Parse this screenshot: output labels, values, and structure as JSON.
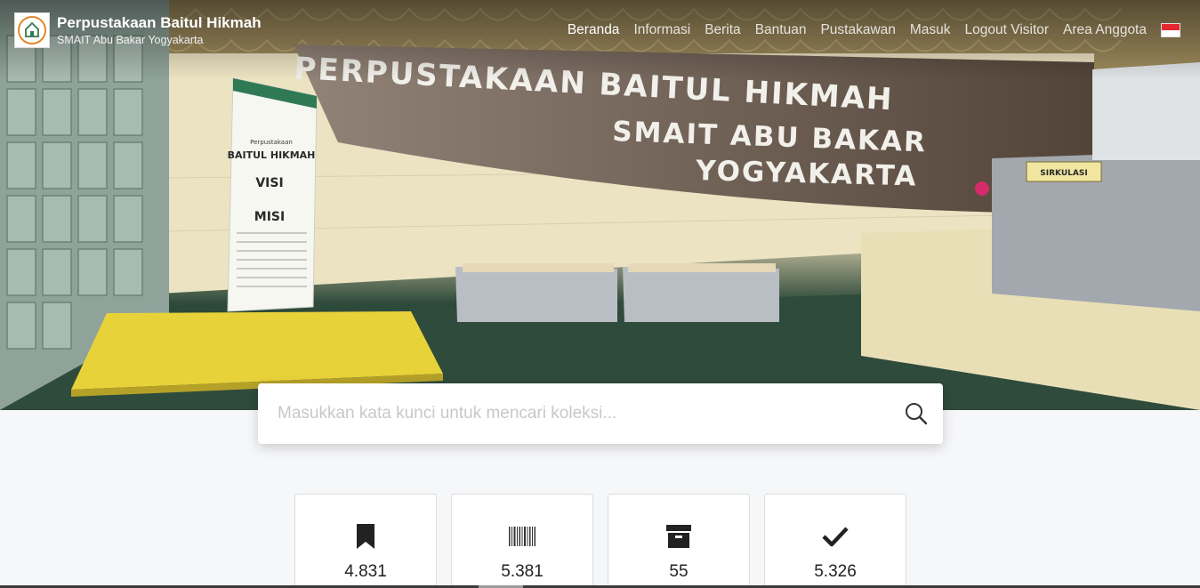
{
  "brand": {
    "title": "Perpustakaan Baitul Hikmah",
    "subtitle": "SMAIT Abu Bakar Yogyakarta",
    "logo_icon": "library-logo-icon"
  },
  "nav": {
    "items": [
      {
        "label": "Beranda",
        "active": true
      },
      {
        "label": "Informasi",
        "active": false
      },
      {
        "label": "Berita",
        "active": false
      },
      {
        "label": "Bantuan",
        "active": false
      },
      {
        "label": "Pustakawan",
        "active": false
      },
      {
        "label": "Masuk",
        "active": false
      },
      {
        "label": "Logout Visitor",
        "active": false
      },
      {
        "label": "Area Anggota",
        "active": false
      }
    ],
    "language_flag": "indonesia-flag-icon"
  },
  "hero": {
    "wall_sign": [
      "PERPUSTAKAAN BAITUL HIKMAH",
      "SMAIT ABU BAKAR",
      "YOGYAKARTA"
    ],
    "banner": {
      "line1": "Perpustakaan",
      "line2": "BAITUL HIKMAH",
      "visi": "VISI",
      "misi": "MISI"
    },
    "counter_sign": "SIRKULASI"
  },
  "search": {
    "placeholder": "Masukkan kata kunci untuk mencari koleksi...",
    "value": "",
    "icon": "search-icon"
  },
  "stats": [
    {
      "icon": "bookmark-icon",
      "value": "4.831"
    },
    {
      "icon": "barcode-icon",
      "value": "5.381"
    },
    {
      "icon": "archive-box-icon",
      "value": "55"
    },
    {
      "icon": "check-icon",
      "value": "5.326"
    }
  ],
  "colors": {
    "header_text": "#ffffff",
    "page_background": "#f6f7f9",
    "flag_red": "#e3262f"
  }
}
